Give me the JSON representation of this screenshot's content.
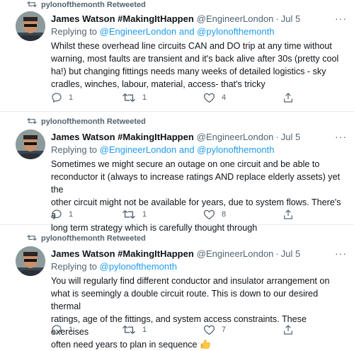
{
  "tweets": [
    {
      "retweeted_by": "pylonofthemonth Retweeted",
      "name": "James Watson #MakingItHappen",
      "handle": "@EngineerLondon",
      "date": "Jul 5",
      "replying_prefix": "Replying to ",
      "replying_to": "@EngineerLondon and @pylonofthemonth",
      "lines": [
        "Whilst these overhead line circuits CAN and DO trip at any time without",
        "warning, most faults are transient and it's back alive after 30s (pretty cool",
        "ha!) but changing fittings needs many weeks of detailed logistics - sky",
        "cradles, winches, labour, material, access- that's tricky"
      ],
      "replies": "1",
      "retweets": "1",
      "likes": "4"
    },
    {
      "retweeted_by": "pylonofthemonth Retweeted",
      "name": "James Watson #MakingItHappen",
      "handle": "@EngineerLondon",
      "date": "Jul 5",
      "replying_prefix": "Replying to ",
      "replying_to": "@EngineerLondon and @pylonofthemonth",
      "lines": [
        "Sometimes we might secure an outage on one circuit and be able to",
        "reconductor it (always to increase ratings AND replace elderly assets) yet the",
        "other circuit might not be available for years, due to system flows. There's a",
        "long term strategy which is carefully thought through"
      ],
      "replies": "1",
      "retweets": "1",
      "likes": "8"
    },
    {
      "retweeted_by": "pylonofthemonth Retweeted",
      "name": "James Watson #MakingItHappen",
      "handle": "@EngineerLondon",
      "date": "Jul 5",
      "replying_prefix": "Replying to ",
      "replying_to": "@pylonofthemonth",
      "lines": [
        "You will regularly find different conductor and insulator arrangement on",
        "what is seemingly a double circuit route. This is down to our desired thermal",
        "ratings, age of the fittings, and system access constraints. These exercises",
        "often need years to plan in sequence"
      ],
      "emoji": "thumbs-up",
      "replies": "1",
      "retweets": "1",
      "likes": "7"
    }
  ],
  "more_label": "···",
  "dot": "·",
  "colors": {
    "link": "#1d9bf0",
    "secondary": "#536471",
    "text": "#0f1419",
    "divider": "#e6ecf0"
  }
}
